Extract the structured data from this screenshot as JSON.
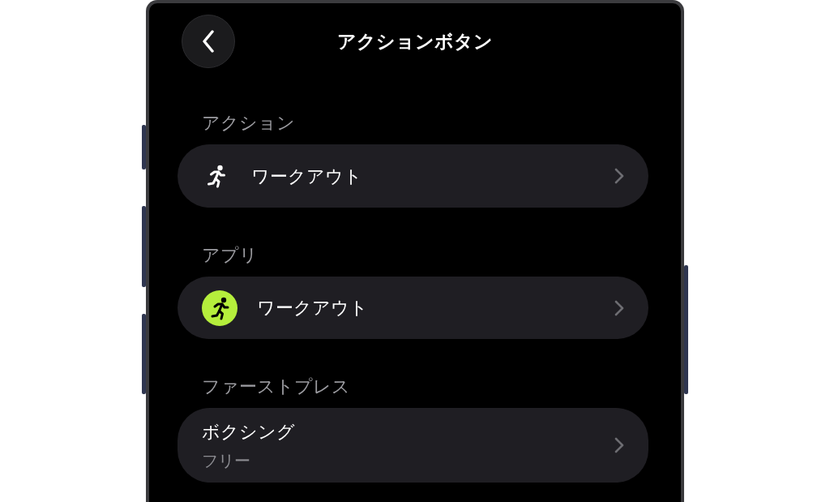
{
  "header": {
    "title": "アクションボタン"
  },
  "sections": [
    {
      "label": "アクション",
      "items": [
        {
          "kind": "symbol",
          "title": "ワークアウト"
        }
      ]
    },
    {
      "label": "アプリ",
      "items": [
        {
          "kind": "app",
          "title": "ワークアウト"
        }
      ]
    },
    {
      "label": "ファーストプレス",
      "items": [
        {
          "kind": "detail",
          "title": "ボクシング",
          "subtitle": "フリー"
        }
      ]
    }
  ]
}
